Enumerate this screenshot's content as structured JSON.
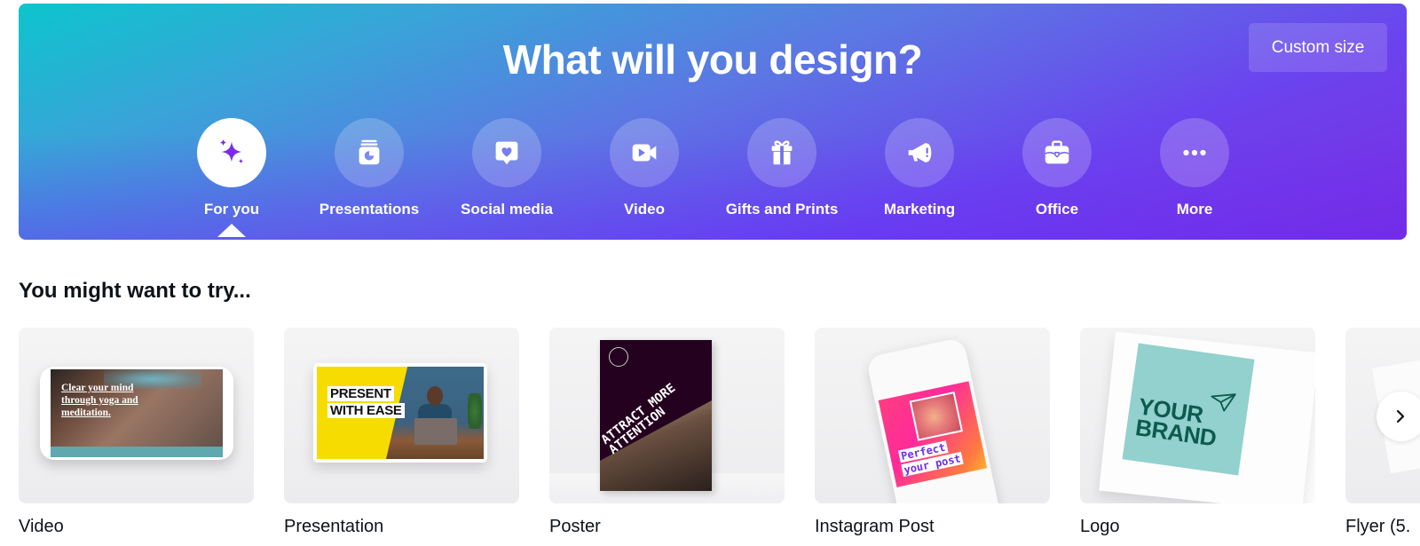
{
  "hero": {
    "title": "What will you design?",
    "custom_size_label": "Custom size",
    "categories": [
      {
        "label": "For you",
        "icon": "sparkle-icon",
        "active": true
      },
      {
        "label": "Presentations",
        "icon": "presentation-icon",
        "active": false
      },
      {
        "label": "Social media",
        "icon": "heart-bubble-icon",
        "active": false
      },
      {
        "label": "Video",
        "icon": "video-camera-icon",
        "active": false
      },
      {
        "label": "Gifts and Prints",
        "icon": "gift-icon",
        "active": false
      },
      {
        "label": "Marketing",
        "icon": "megaphone-icon",
        "active": false
      },
      {
        "label": "Office",
        "icon": "briefcase-icon",
        "active": false
      },
      {
        "label": "More",
        "icon": "more-dots-icon",
        "active": false
      }
    ],
    "colors": {
      "gradient_start": "#0cc5cd",
      "gradient_mid": "#5b78e3",
      "gradient_end": "#7b2de0",
      "active_icon": "#7d2ae8"
    }
  },
  "suggestions": {
    "title": "You might want to try...",
    "next_icon": "chevron-right-icon",
    "items": [
      {
        "label": "Video",
        "thumb_text": "Clear your mind through yoga and meditation."
      },
      {
        "label": "Presentation",
        "thumb_text_line1": "PRESENT",
        "thumb_text_line2": "WITH EASE"
      },
      {
        "label": "Poster",
        "thumb_text": "ATTRACT MORE ATTENTION"
      },
      {
        "label": "Instagram Post",
        "thumb_text_line1": "Perfect",
        "thumb_text_line2": "your post"
      },
      {
        "label": "Logo",
        "thumb_text_line1": "YOUR",
        "thumb_text_line2": "BRAND"
      },
      {
        "label": "Flyer (5."
      }
    ]
  }
}
